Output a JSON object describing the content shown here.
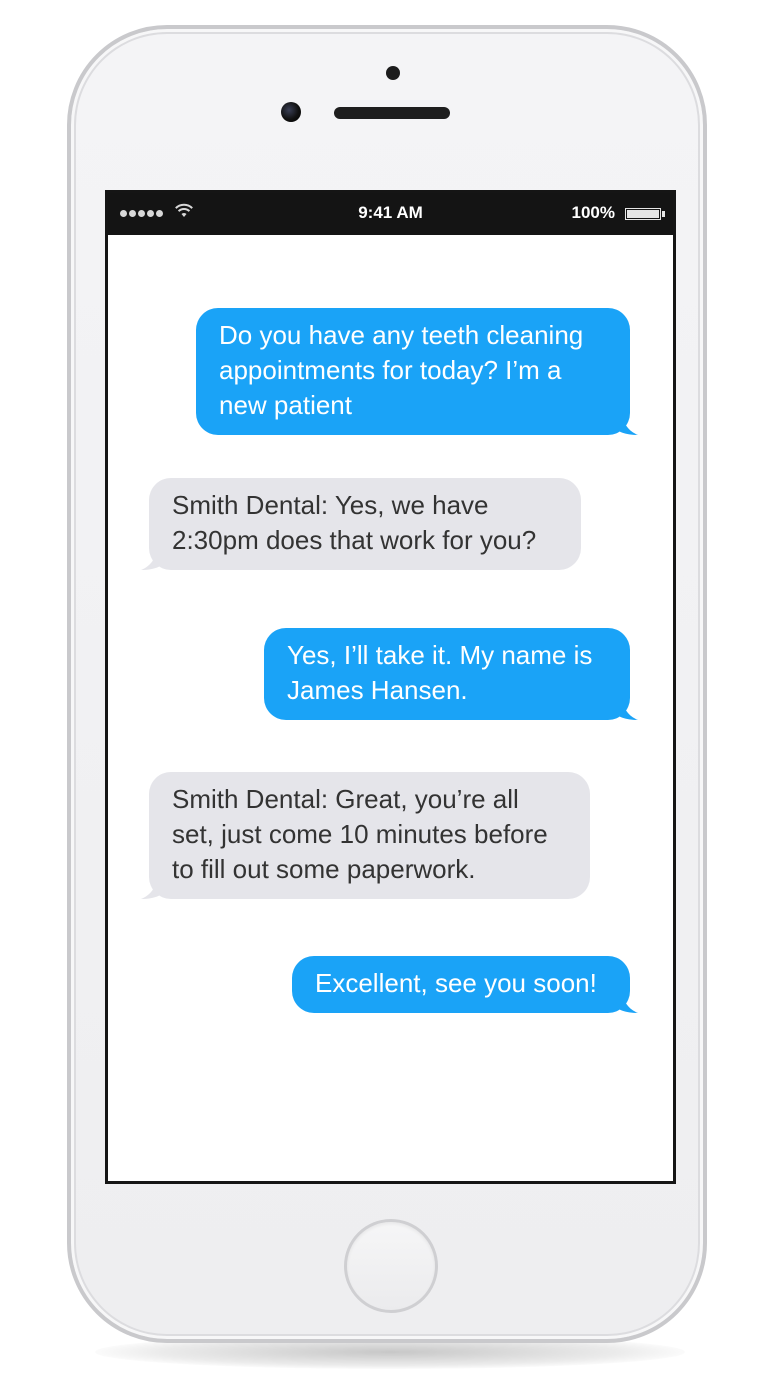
{
  "status_bar": {
    "time": "9:41 AM",
    "battery_percent": "100%",
    "signal_bars": 5,
    "wifi_icon": "wifi-icon",
    "battery_level": 1.0
  },
  "conversation": {
    "messages": [
      {
        "direction": "outgoing",
        "text": "Do you have any teeth cleaning appointments for today? I’m a new patient"
      },
      {
        "direction": "incoming",
        "text": "Smith Dental: Yes, we have 2:30pm does that work for you?"
      },
      {
        "direction": "outgoing",
        "text": "Yes, I’ll take it. My name is James Hansen."
      },
      {
        "direction": "incoming",
        "text": "Smith Dental: Great, you’re all set, just come 10 minutes before to fill out some paperwork."
      },
      {
        "direction": "outgoing",
        "text": "Excellent, see you soon!"
      }
    ]
  },
  "colors": {
    "outgoing_bubble": "#1aa3f7",
    "incoming_bubble": "#e5e5ea",
    "status_bar": "#141414"
  }
}
